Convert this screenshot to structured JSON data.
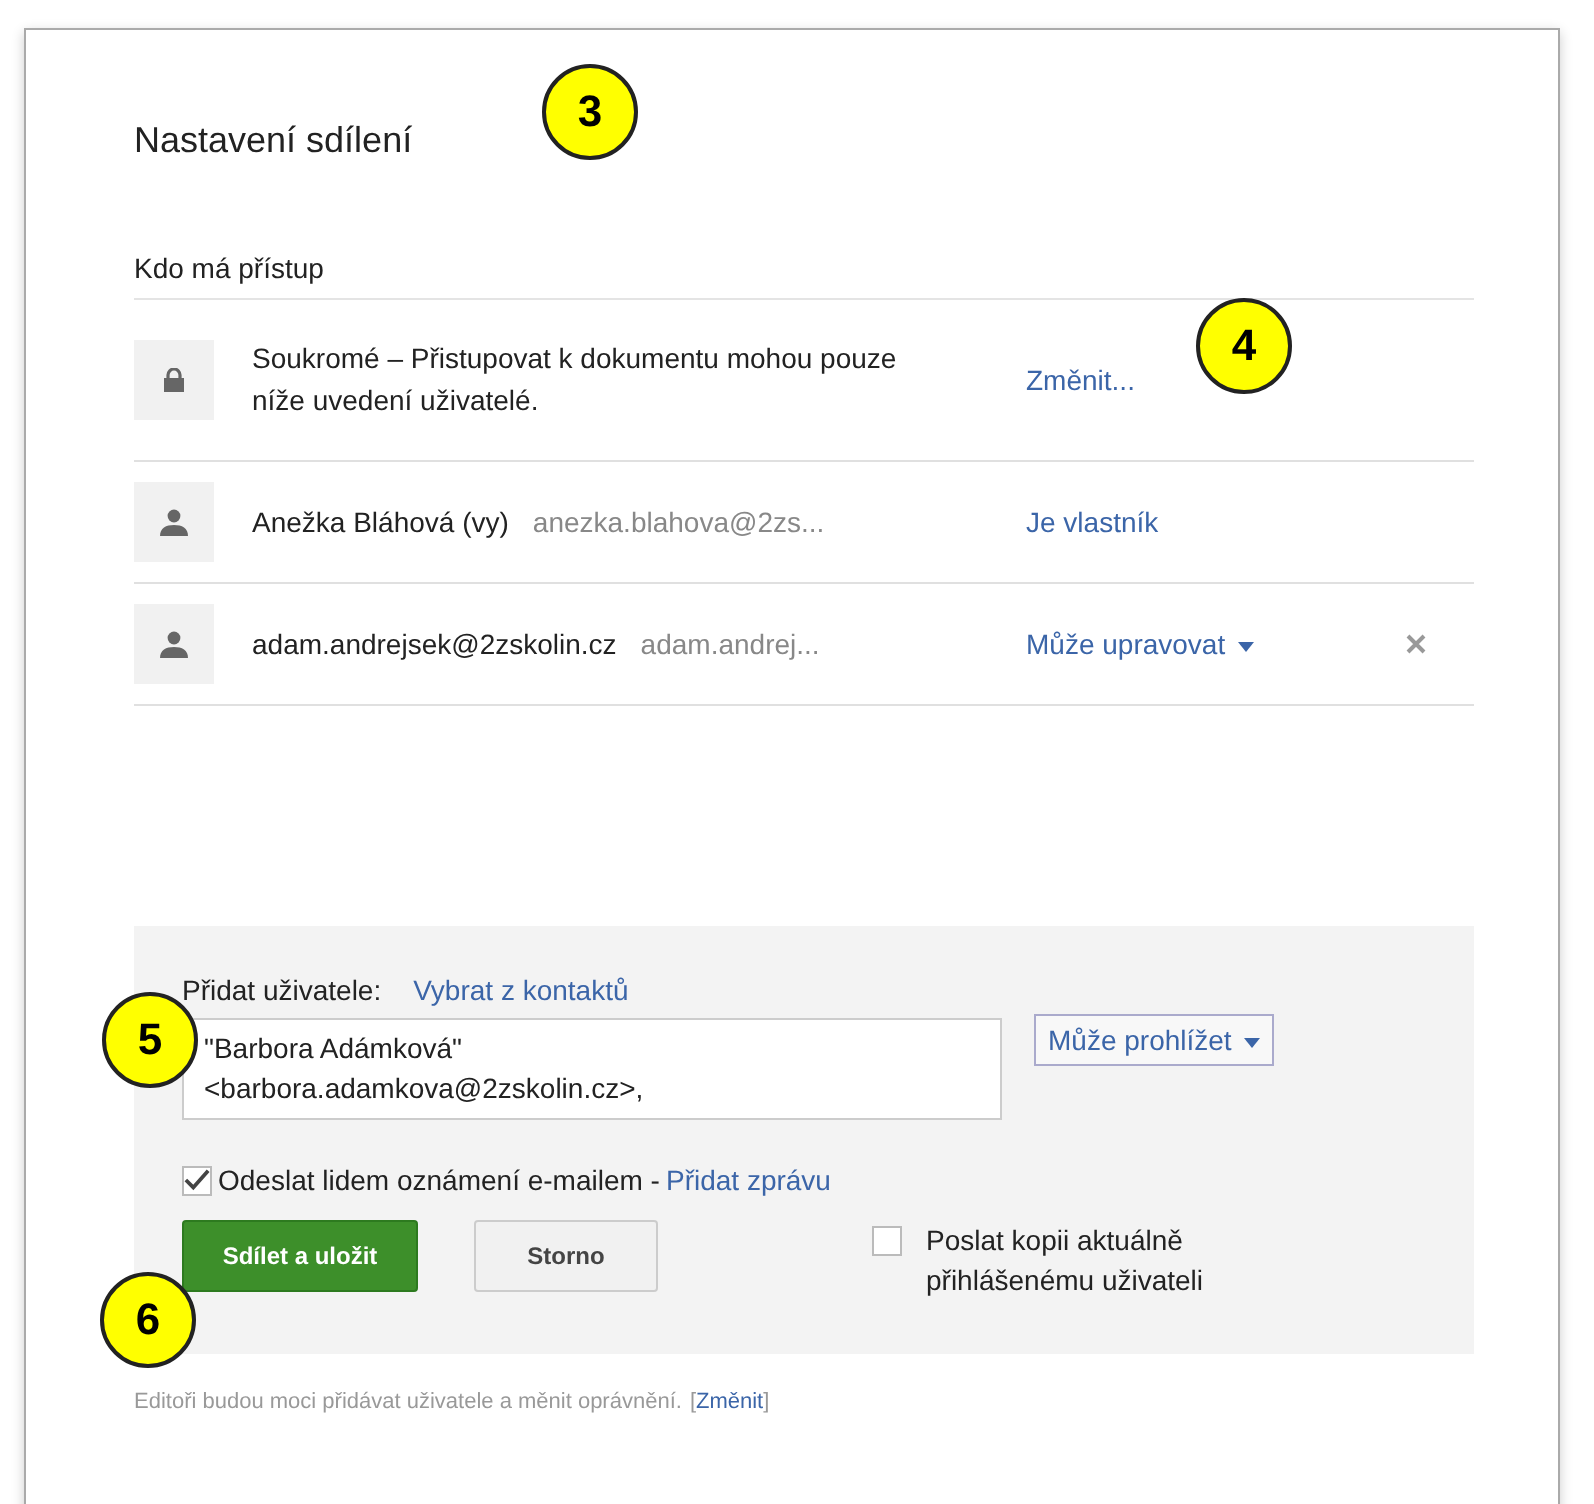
{
  "dialog": {
    "title": "Nastavení sdílení",
    "access_heading": "Kdo má přístup"
  },
  "access_rows": [
    {
      "kind": "visibility",
      "text": "Soukromé – Přistupovat k dokumentu mohou pouze níže uvedení uživatelé.",
      "action": "Změnit...",
      "dropdown": false,
      "removable": false
    },
    {
      "kind": "person",
      "name": "Anežka Bláhová (vy)",
      "email": "anezka.blahova@2zs...",
      "action": "Je vlastník",
      "dropdown": false,
      "removable": false
    },
    {
      "kind": "person",
      "name": "adam.andrejsek@2zskolin.cz",
      "email": "adam.andrej...",
      "action": "Může upravovat",
      "dropdown": true,
      "removable": true
    }
  ],
  "add_people": {
    "label": "Přidat uživatele:",
    "contacts_link": "Vybrat z kontaktů",
    "value_lines": [
      "\"Barbora Adámková\"",
      "<barbora.adamkova@2zskolin.cz>,"
    ],
    "permission": "Může prohlížet"
  },
  "notify": {
    "checked": true,
    "label": "Odeslat lidem oznámení e-mailem -",
    "link": "Přidat zprávu"
  },
  "buttons": {
    "primary": "Sdílet a uložit",
    "secondary": "Storno"
  },
  "send_copy": {
    "checked": false,
    "label": "Poslat kopii aktuálně přihlášenému uživateli"
  },
  "footer": {
    "text": "Editoři budou moci přidávat uživatele a měnit oprávnění.",
    "open_bracket": "[",
    "link": "Změnit",
    "close_bracket": "]"
  },
  "callouts": [
    {
      "label": "3"
    },
    {
      "label": "4"
    },
    {
      "label": "5"
    },
    {
      "label": "6"
    }
  ]
}
